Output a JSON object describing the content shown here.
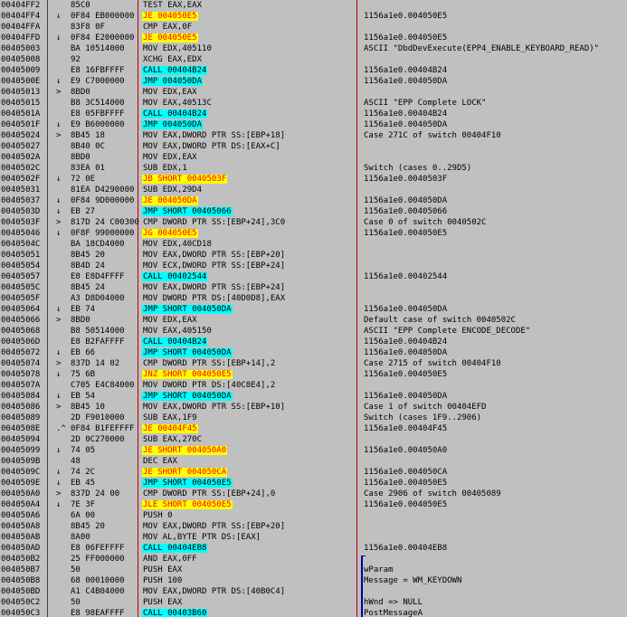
{
  "rows": [
    {
      "addr": "00404FF2",
      "mark": "",
      "hex": "85C0",
      "asm": "TEST EAX,EAX",
      "kind": "",
      "cmt": ""
    },
    {
      "addr": "00404FF4",
      "mark": "↓",
      "hex": "0F84 EB000000",
      "asm": "JE 004050E5",
      "kind": "jcc",
      "cmt": "1156a1e0.004050E5"
    },
    {
      "addr": "00404FFA",
      "mark": "",
      "hex": "83F8 0F",
      "asm": "CMP EAX,0F",
      "kind": "",
      "cmt": ""
    },
    {
      "addr": "00404FFD",
      "mark": "↓",
      "hex": "0F84 E2000000",
      "asm": "JE 004050E5",
      "kind": "jcc",
      "cmt": "1156a1e0.004050E5"
    },
    {
      "addr": "00405003",
      "mark": "",
      "hex": "BA 10514000",
      "asm": "MOV EDX,405110",
      "kind": "",
      "cmt": "ASCII \"DbdDevExecute(EPP4_ENABLE_KEYBOARD_READ)\""
    },
    {
      "addr": "00405008",
      "mark": "",
      "hex": "92",
      "asm": "XCHG EAX,EDX",
      "kind": "",
      "cmt": ""
    },
    {
      "addr": "00405009",
      "mark": "",
      "hex": "E8 16FBFFFF",
      "asm": "CALL 00404B24",
      "kind": "call",
      "cmt": "1156a1e0.00404B24"
    },
    {
      "addr": "0040500E",
      "mark": "↓",
      "hex": "E9 C7000000",
      "asm": "JMP 004050DA",
      "kind": "jmp",
      "cmt": "1156a1e0.004050DA"
    },
    {
      "addr": "00405013",
      "mark": ">",
      "hex": "8BD0",
      "asm": "MOV EDX,EAX",
      "kind": "",
      "cmt": ""
    },
    {
      "addr": "00405015",
      "mark": "",
      "hex": "B8 3C514000",
      "asm": "MOV EAX,40513C",
      "kind": "",
      "cmt": "ASCII \"EPP Complete LOCK\""
    },
    {
      "addr": "0040501A",
      "mark": "",
      "hex": "E8 05FBFFFF",
      "asm": "CALL 00404B24",
      "kind": "call",
      "cmt": "1156a1e0.00404B24"
    },
    {
      "addr": "0040501F",
      "mark": "↓",
      "hex": "E9 B6000000",
      "asm": "JMP 004050DA",
      "kind": "jmp",
      "cmt": "1156a1e0.004050DA"
    },
    {
      "addr": "00405024",
      "mark": ">",
      "hex": "8B45 18",
      "asm": "MOV EAX,DWORD PTR SS:[EBP+18]",
      "kind": "",
      "cmt": "Case 271C of switch 00404F10"
    },
    {
      "addr": "00405027",
      "mark": "",
      "hex": "8B40 0C",
      "asm": "MOV EAX,DWORD PTR DS:[EAX+C]",
      "kind": "",
      "cmt": ""
    },
    {
      "addr": "0040502A",
      "mark": "",
      "hex": "8BD0",
      "asm": "MOV EDX,EAX",
      "kind": "",
      "cmt": ""
    },
    {
      "addr": "0040502C",
      "mark": "",
      "hex": "83EA 01",
      "asm": "SUB EDX,1",
      "kind": "",
      "cmt": "Switch (cases 0..29D5)"
    },
    {
      "addr": "0040502F",
      "mark": "↓",
      "hex": "72 0E",
      "asm": "JB SHORT 0040503F",
      "kind": "jcc",
      "cmt": "1156a1e0.0040503F"
    },
    {
      "addr": "00405031",
      "mark": "",
      "hex": "81EA D4290000",
      "asm": "SUB EDX,29D4",
      "kind": "",
      "cmt": ""
    },
    {
      "addr": "00405037",
      "mark": "↓",
      "hex": "0F84 9D000000",
      "asm": "JE 004050DA",
      "kind": "jcc",
      "cmt": "1156a1e0.004050DA"
    },
    {
      "addr": "0040503D",
      "mark": "↓",
      "hex": "EB 27",
      "asm": "JMP SHORT 00405066",
      "kind": "jmp",
      "cmt": "1156a1e0.00405066"
    },
    {
      "addr": "0040503F",
      "mark": ">",
      "hex": "817D 24 C0030000",
      "asm": "CMP DWORD PTR SS:[EBP+24],3C0",
      "kind": "",
      "cmt": "Case 0 of switch 0040502C"
    },
    {
      "addr": "00405046",
      "mark": "↓",
      "hex": "0F8F 99000000",
      "asm": "JG 004050E5",
      "kind": "jcc",
      "cmt": "1156a1e0.004050E5"
    },
    {
      "addr": "0040504C",
      "mark": "",
      "hex": "BA 18CD4000",
      "asm": "MOV EDX,40CD18",
      "kind": "",
      "cmt": ""
    },
    {
      "addr": "00405051",
      "mark": "",
      "hex": "8B45 20",
      "asm": "MOV EAX,DWORD PTR SS:[EBP+20]",
      "kind": "",
      "cmt": ""
    },
    {
      "addr": "00405054",
      "mark": "",
      "hex": "8B4D 24",
      "asm": "MOV ECX,DWORD PTR SS:[EBP+24]",
      "kind": "",
      "cmt": ""
    },
    {
      "addr": "00405057",
      "mark": "",
      "hex": "E8 E8D4FFFF",
      "asm": "CALL 00402544",
      "kind": "call",
      "cmt": "1156a1e0.00402544"
    },
    {
      "addr": "0040505C",
      "mark": "",
      "hex": "8B45 24",
      "asm": "MOV EAX,DWORD PTR SS:[EBP+24]",
      "kind": "",
      "cmt": ""
    },
    {
      "addr": "0040505F",
      "mark": "",
      "hex": "A3 D8D04000",
      "asm": "MOV DWORD PTR DS:[40D0D8],EAX",
      "kind": "",
      "cmt": ""
    },
    {
      "addr": "00405064",
      "mark": "↓",
      "hex": "EB 74",
      "asm": "JMP SHORT 004050DA",
      "kind": "jmp",
      "cmt": "1156a1e0.004050DA"
    },
    {
      "addr": "00405066",
      "mark": ">",
      "hex": "8BD0",
      "asm": "MOV EDX,EAX",
      "kind": "",
      "cmt": "Default case of switch 0040502C"
    },
    {
      "addr": "00405068",
      "mark": "",
      "hex": "B8 50514000",
      "asm": "MOV EAX,405150",
      "kind": "",
      "cmt": "ASCII \"EPP Complete ENCODE_DECODE\""
    },
    {
      "addr": "0040506D",
      "mark": "",
      "hex": "E8 B2FAFFFF",
      "asm": "CALL 00404B24",
      "kind": "call",
      "cmt": "1156a1e0.00404B24"
    },
    {
      "addr": "00405072",
      "mark": "↓",
      "hex": "EB 66",
      "asm": "JMP SHORT 004050DA",
      "kind": "jmp",
      "cmt": "1156a1e0.004050DA"
    },
    {
      "addr": "00405074",
      "mark": ">",
      "hex": "837D 14 02",
      "asm": "CMP DWORD PTR SS:[EBP+14],2",
      "kind": "",
      "cmt": "Case 2715 of switch 00404F10"
    },
    {
      "addr": "00405078",
      "mark": "↓",
      "hex": "75 6B",
      "asm": "JNZ SHORT 004050E5",
      "kind": "jcc",
      "cmt": "1156a1e0.004050E5"
    },
    {
      "addr": "0040507A",
      "mark": "",
      "hex": "C705 E4C84000",
      "asm": "MOV DWORD PTR DS:[40C8E4],2",
      "kind": "",
      "cmt": ""
    },
    {
      "addr": "00405084",
      "mark": "↓",
      "hex": "EB 54",
      "asm": "JMP SHORT 004050DA",
      "kind": "jmp",
      "cmt": "1156a1e0.004050DA"
    },
    {
      "addr": "00405086",
      "mark": ">",
      "hex": "8B45 10",
      "asm": "MOV EAX,DWORD PTR SS:[EBP+10]",
      "kind": "",
      "cmt": "Case 1 of switch 00404EFD"
    },
    {
      "addr": "00405089",
      "mark": "",
      "hex": "2D F9010000",
      "asm": "SUB EAX,1F9",
      "kind": "",
      "cmt": "Switch (cases 1F9..2906)"
    },
    {
      "addr": "0040508E",
      "mark": ".^",
      "hex": "0F84 B1FEFFFF",
      "asm": "JE 00404F45",
      "kind": "jcc",
      "cmt": "1156a1e0.00404F45"
    },
    {
      "addr": "00405094",
      "mark": "",
      "hex": "2D 0C270000",
      "asm": "SUB EAX,270C",
      "kind": "",
      "cmt": ""
    },
    {
      "addr": "00405099",
      "mark": "↓",
      "hex": "74 05",
      "asm": "JE SHORT 004050A0",
      "kind": "jcc",
      "cmt": "1156a1e0.004050A0"
    },
    {
      "addr": "0040509B",
      "mark": "",
      "hex": "48",
      "asm": "DEC EAX",
      "kind": "",
      "cmt": ""
    },
    {
      "addr": "0040509C",
      "mark": "↓",
      "hex": "74 2C",
      "asm": "JE SHORT 004050CA",
      "kind": "jcc",
      "cmt": "1156a1e0.004050CA"
    },
    {
      "addr": "0040509E",
      "mark": "↓",
      "hex": "EB 45",
      "asm": "JMP SHORT 004050E5",
      "kind": "jmp",
      "cmt": "1156a1e0.004050E5"
    },
    {
      "addr": "004050A0",
      "mark": ">",
      "hex": "837D 24 00",
      "asm": "CMP DWORD PTR SS:[EBP+24],0",
      "kind": "",
      "cmt": "Case 2906 of switch 00405089"
    },
    {
      "addr": "004050A4",
      "mark": "↓",
      "hex": "7E 3F",
      "asm": "JLE SHORT 004050E5",
      "kind": "jcc",
      "cmt": "1156a1e0.004050E5"
    },
    {
      "addr": "004050A6",
      "mark": "",
      "hex": "6A 00",
      "asm": "PUSH 0",
      "kind": "",
      "cmt": ""
    },
    {
      "addr": "004050A8",
      "mark": "",
      "hex": "8B45 20",
      "asm": "MOV EAX,DWORD PTR SS:[EBP+20]",
      "kind": "",
      "cmt": ""
    },
    {
      "addr": "004050AB",
      "mark": "",
      "hex": "8A00",
      "asm": "MOV AL,BYTE PTR DS:[EAX]",
      "kind": "",
      "cmt": ""
    },
    {
      "addr": "004050AD",
      "mark": "",
      "hex": "E8 06FEFFFF",
      "asm": "CALL 00404EB8",
      "kind": "call",
      "cmt": "1156a1e0.00404EB8"
    },
    {
      "addr": "004050B2",
      "mark": "",
      "hex": "25 FF000000",
      "asm": "AND EAX,0FF",
      "kind": "",
      "cmt": ""
    },
    {
      "addr": "004050B7",
      "mark": "",
      "hex": "50",
      "asm": "PUSH EAX",
      "kind": "",
      "cmt": "wParam"
    },
    {
      "addr": "004050B8",
      "mark": "",
      "hex": "68 00010000",
      "asm": "PUSH 100",
      "kind": "",
      "cmt": "Message = WM_KEYDOWN"
    },
    {
      "addr": "004050BD",
      "mark": "",
      "hex": "A1 C4B04000",
      "asm": "MOV EAX,DWORD PTR DS:[40B0C4]",
      "kind": "",
      "cmt": ""
    },
    {
      "addr": "004050C2",
      "mark": "",
      "hex": "50",
      "asm": "PUSH EAX",
      "kind": "",
      "cmt": "hWnd => NULL"
    },
    {
      "addr": "004050C3",
      "mark": "",
      "hex": "E8 98EAFFFF",
      "asm": "CALL 00403B60",
      "kind": "call",
      "cmt": "PostMessageA"
    }
  ]
}
